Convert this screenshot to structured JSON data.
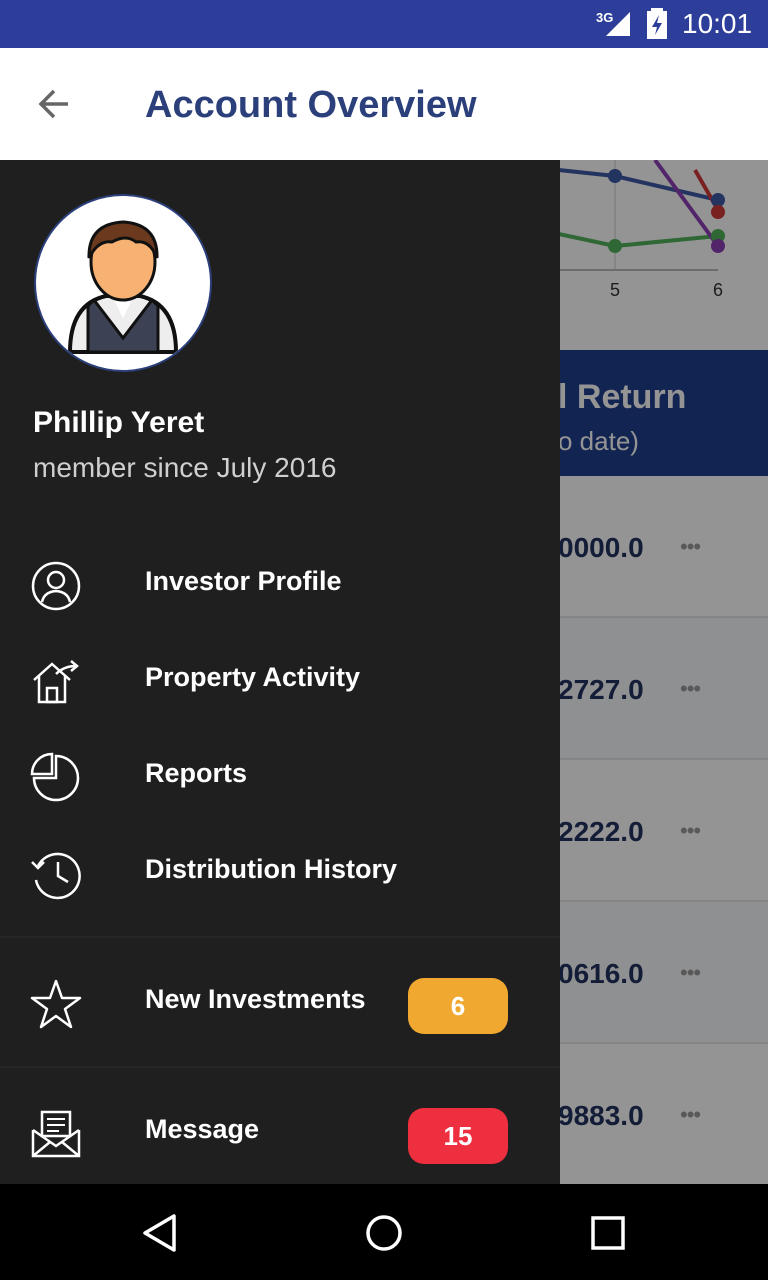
{
  "status_bar": {
    "network": "3G",
    "time": "10:01"
  },
  "app_bar": {
    "title": "Account Overview"
  },
  "background": {
    "chart_tick_labels": [
      "5",
      "6"
    ],
    "section_title": "l Return",
    "section_subtitle": "o date)",
    "rows": [
      {
        "amount": "0000.0"
      },
      {
        "amount": "2727.0"
      },
      {
        "amount": "2222.0"
      },
      {
        "amount": "0616.0"
      },
      {
        "amount": "9883.0"
      }
    ],
    "more_label": "•••"
  },
  "drawer": {
    "user": {
      "name": "Phillip Yeret",
      "member_since": "member since July 2016"
    },
    "menu": [
      {
        "label": "Investor Profile",
        "icon": "user-circle-icon"
      },
      {
        "label": "Property Activity",
        "icon": "house-arrow-icon"
      },
      {
        "label": "Reports",
        "icon": "pie-chart-icon"
      },
      {
        "label": "Distribution History",
        "icon": "history-icon"
      }
    ],
    "secondary": [
      {
        "label": "New Investments",
        "icon": "star-icon",
        "badge": "6",
        "badge_color": "#f0a830"
      },
      {
        "label": "Message",
        "icon": "mail-icon",
        "badge": "15",
        "badge_color": "#ee2f3f"
      }
    ]
  },
  "colors": {
    "status_bar": "#2d3e9a",
    "title": "#2b3f7a",
    "drawer_bg": "#1f1f1f"
  }
}
